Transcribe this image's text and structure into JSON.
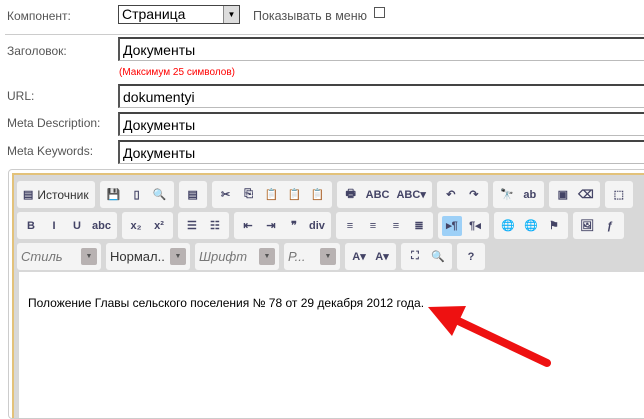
{
  "form": {
    "component_label": "Компонент:",
    "component_value": "Страница",
    "show_in_menu_label": "Показывать в меню",
    "title_label": "Заголовок:",
    "title_value": "Документы",
    "title_hint": "(Максимум 25 символов)",
    "url_label": "URL:",
    "url_value": "dokumentyi",
    "meta_desc_label": "Meta Description:",
    "meta_desc_value": "Документы",
    "meta_kw_label": "Meta Keywords:",
    "meta_kw_value": "Документы"
  },
  "toolbar": {
    "row1": [
      [
        {
          "icon": "source-icon",
          "label": "Источник",
          "glyph": "▤"
        }
      ],
      [
        {
          "icon": "save-icon",
          "glyph": "💾"
        },
        {
          "icon": "new-page-icon",
          "glyph": "▯"
        },
        {
          "icon": "preview-icon",
          "glyph": "🔍"
        }
      ],
      [
        {
          "icon": "templates-icon",
          "glyph": "▤"
        }
      ],
      [
        {
          "icon": "cut-icon",
          "glyph": "✂"
        },
        {
          "icon": "copy-icon",
          "glyph": "⎘"
        },
        {
          "icon": "paste-icon",
          "glyph": "📋"
        },
        {
          "icon": "paste-text-icon",
          "glyph": "📋"
        },
        {
          "icon": "paste-word-icon",
          "glyph": "📋"
        }
      ],
      [
        {
          "icon": "print-icon",
          "glyph": "🖶"
        },
        {
          "icon": "spellcheck-icon",
          "glyph": "ABC"
        },
        {
          "icon": "spellcheck-dropdown-icon",
          "glyph": "ABC▾"
        }
      ],
      [
        {
          "icon": "undo-icon",
          "glyph": "↶"
        },
        {
          "icon": "redo-icon",
          "glyph": "↷"
        }
      ],
      [
        {
          "icon": "find-icon",
          "glyph": "🔭"
        },
        {
          "icon": "replace-icon",
          "glyph": "ab"
        }
      ],
      [
        {
          "icon": "select-all-icon",
          "glyph": "▣"
        },
        {
          "icon": "remove-format-icon",
          "glyph": "⌫"
        }
      ],
      [
        {
          "icon": "show-blocks-icon",
          "glyph": "⬚"
        }
      ]
    ],
    "row2": [
      [
        {
          "icon": "bold-icon",
          "glyph": "B"
        },
        {
          "icon": "italic-icon",
          "glyph": "I"
        },
        {
          "icon": "underline-icon",
          "glyph": "U"
        },
        {
          "icon": "strike-icon",
          "glyph": "abc"
        }
      ],
      [
        {
          "icon": "subscript-icon",
          "glyph": "x₂"
        },
        {
          "icon": "superscript-icon",
          "glyph": "x²"
        }
      ],
      [
        {
          "icon": "numbered-list-icon",
          "glyph": "☰"
        },
        {
          "icon": "bulleted-list-icon",
          "glyph": "☷"
        }
      ],
      [
        {
          "icon": "outdent-icon",
          "glyph": "⇤"
        },
        {
          "icon": "indent-icon",
          "glyph": "⇥"
        },
        {
          "icon": "blockquote-icon",
          "glyph": "❞"
        },
        {
          "icon": "div-icon",
          "glyph": "div"
        }
      ],
      [
        {
          "icon": "align-left-icon",
          "glyph": "≡"
        },
        {
          "icon": "align-center-icon",
          "glyph": "≡"
        },
        {
          "icon": "align-right-icon",
          "glyph": "≡"
        },
        {
          "icon": "justify-icon",
          "glyph": "≣"
        }
      ],
      [
        {
          "icon": "ltr-icon",
          "glyph": "▸¶",
          "active": true
        },
        {
          "icon": "rtl-icon",
          "glyph": "¶◂"
        }
      ],
      [
        {
          "icon": "link-icon",
          "glyph": "🌐"
        },
        {
          "icon": "unlink-icon",
          "glyph": "🌐"
        },
        {
          "icon": "anchor-icon",
          "glyph": "⚑"
        }
      ],
      [
        {
          "icon": "image-icon",
          "glyph": "🖼"
        },
        {
          "icon": "flash-icon",
          "glyph": "ƒ"
        }
      ]
    ],
    "row3_combos": [
      {
        "name": "style-combo",
        "label": "Стиль",
        "italic": true
      },
      {
        "name": "format-combo",
        "label": "Нормал...",
        "italic": false
      },
      {
        "name": "font-combo",
        "label": "Шрифт",
        "italic": true
      },
      {
        "name": "size-combo",
        "label": "Р...",
        "italic": true
      }
    ],
    "row3": [
      [
        {
          "icon": "text-color-icon",
          "glyph": "A▾"
        },
        {
          "icon": "bg-color-icon",
          "glyph": "A▾"
        }
      ],
      [
        {
          "icon": "maximize-icon",
          "glyph": "⛶"
        },
        {
          "icon": "show-blocks-preview-icon",
          "glyph": "🔍"
        }
      ],
      [
        {
          "icon": "help-icon",
          "glyph": "?"
        }
      ]
    ]
  },
  "content": {
    "text": "Положение Главы сельского поселения № 78 от 29 декабря 2012 года."
  },
  "colors": {
    "hint": "#ff0000",
    "arrow": "#ee1111",
    "frame": "#e3c27a",
    "active_button": "#9dd0f7"
  }
}
